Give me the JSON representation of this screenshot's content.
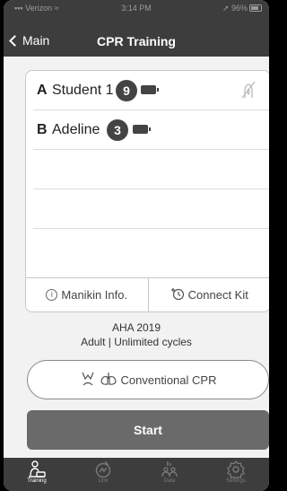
{
  "status": {
    "carrier": "Verizon",
    "time": "3:14 PM",
    "battery": "96%"
  },
  "nav": {
    "back_label": "Main",
    "title": "CPR Training"
  },
  "students": [
    {
      "letter": "A",
      "name": "Student 1",
      "count": "9"
    },
    {
      "letter": "B",
      "name": "Adeline",
      "count": "3"
    }
  ],
  "card_footer": {
    "info_label": "Manikin Info.",
    "connect_label": "Connect Kit"
  },
  "protocol": {
    "standard": "AHA 2019",
    "details": "Adult | Unlimited cycles"
  },
  "mode_button": {
    "label": "Conventional CPR"
  },
  "start_button": {
    "label": "Start"
  },
  "tabs": [
    {
      "label": "Training",
      "icon": "training-icon",
      "active": true
    },
    {
      "label": "Link",
      "icon": "link-icon",
      "active": false
    },
    {
      "label": "Data",
      "icon": "data-icon",
      "active": false
    },
    {
      "label": "Settings",
      "icon": "settings-icon",
      "active": false
    }
  ]
}
